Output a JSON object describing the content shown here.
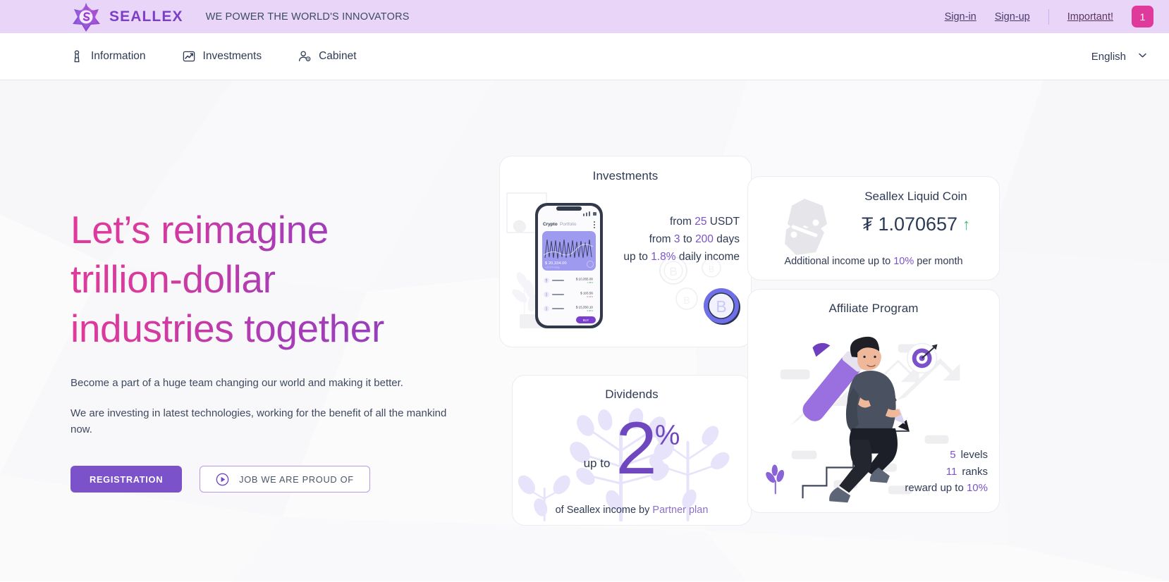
{
  "topbar": {
    "brand": "SEALLEX",
    "tagline": "WE POWER THE WORLD'S INNOVATORS",
    "signin": "Sign-in",
    "signup": "Sign-up",
    "important": "Important!",
    "badge": "1",
    "bg_color": "#e9d5f7",
    "badge_color": "#e0399c"
  },
  "nav": {
    "items": [
      {
        "label": "Information",
        "icon": "info-tower-icon"
      },
      {
        "label": "Investments",
        "icon": "chart-line-icon"
      },
      {
        "label": "Cabinet",
        "icon": "user-gear-icon"
      }
    ],
    "language": "English",
    "chevron": "chevron-down-icon"
  },
  "hero": {
    "title_line1": "Let’s reimagine",
    "title_line2": "trillion-dollar",
    "title_line3": "industries together",
    "paragraph1": "Become a part of a huge team changing our world and making it better.",
    "paragraph2": "We are investing in latest technologies, working for the benefit of all the mankind now.",
    "btn_primary": "REGISTRATION",
    "btn_secondary": "JOB WE ARE PROUD OF",
    "accent_pink": "#e0399c",
    "accent_purple": "#7b52c9"
  },
  "cards": {
    "investments": {
      "title": "Investments",
      "line1_pre": "from ",
      "line1_num": "25",
      "line1_post": " USDT",
      "line2_pre": "from ",
      "line2_num1": "3",
      "line2_mid": " to ",
      "line2_num2": "200",
      "line2_post": " days",
      "line3_pre": "up to ",
      "line3_num": "1.8%",
      "line3_post": " daily income",
      "phone_app_title_strong": "Crypto",
      "phone_app_title_light": "Portfolio",
      "phone_balance": "$ 20,334.00",
      "phone_rows": [
        {
          "value": "$ 10,355.00",
          "change": "1.98%"
        },
        {
          "value": "$ 103.56",
          "change": "-6.24%"
        },
        {
          "value": "$ 15,350.10",
          "change": "5.86%"
        }
      ],
      "phone_button": "BUY"
    },
    "dividends": {
      "title": "Dividends",
      "up_to": "up to",
      "number": "2",
      "percent": "%",
      "footer_pre": "of Seallex income by ",
      "footer_link": "Partner plan"
    },
    "liquid_coin": {
      "title": "Seallex Liquid Coin",
      "symbol": "₮",
      "price": "1.070657",
      "trend": "↑",
      "trend_color": "#2fbf6c",
      "note_pre": "Additional income up to ",
      "note_num": "10%",
      "note_post": " per month"
    },
    "affiliate": {
      "title": "Affiliate Program",
      "stats": [
        {
          "num": "5",
          "label": "levels"
        },
        {
          "num": "11",
          "label": "ranks"
        }
      ],
      "reward_pre": "reward up to ",
      "reward_num": "10%"
    }
  }
}
